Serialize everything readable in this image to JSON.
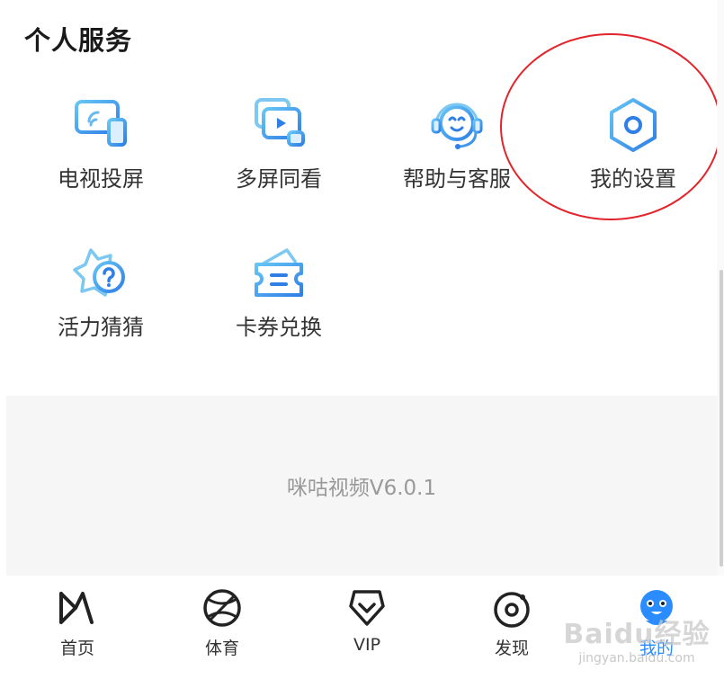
{
  "section": {
    "title": "个人服务"
  },
  "services": [
    {
      "label": "电视投屏"
    },
    {
      "label": "多屏同看"
    },
    {
      "label": "帮助与客服"
    },
    {
      "label": "我的设置"
    },
    {
      "label": "活力猜猜"
    },
    {
      "label": "卡券兑换"
    }
  ],
  "footer": {
    "version": "咪咕视频V6.0.1"
  },
  "tabbar": {
    "items": [
      {
        "label": "首页",
        "icon": "migu-logo-icon"
      },
      {
        "label": "体育",
        "icon": "basketball-icon"
      },
      {
        "label": "VIP",
        "icon": "vip-diamond-icon"
      },
      {
        "label": "发现",
        "icon": "discover-icon"
      },
      {
        "label": "我的",
        "icon": "mascot-avatar-icon",
        "active": true
      }
    ]
  },
  "watermark": {
    "main": "Baidu经验",
    "sub": "jingyan.baidu.com"
  },
  "colors": {
    "accent": "#2b8cff",
    "annotation": "#e3242b",
    "panel": "#f6f6f6"
  }
}
